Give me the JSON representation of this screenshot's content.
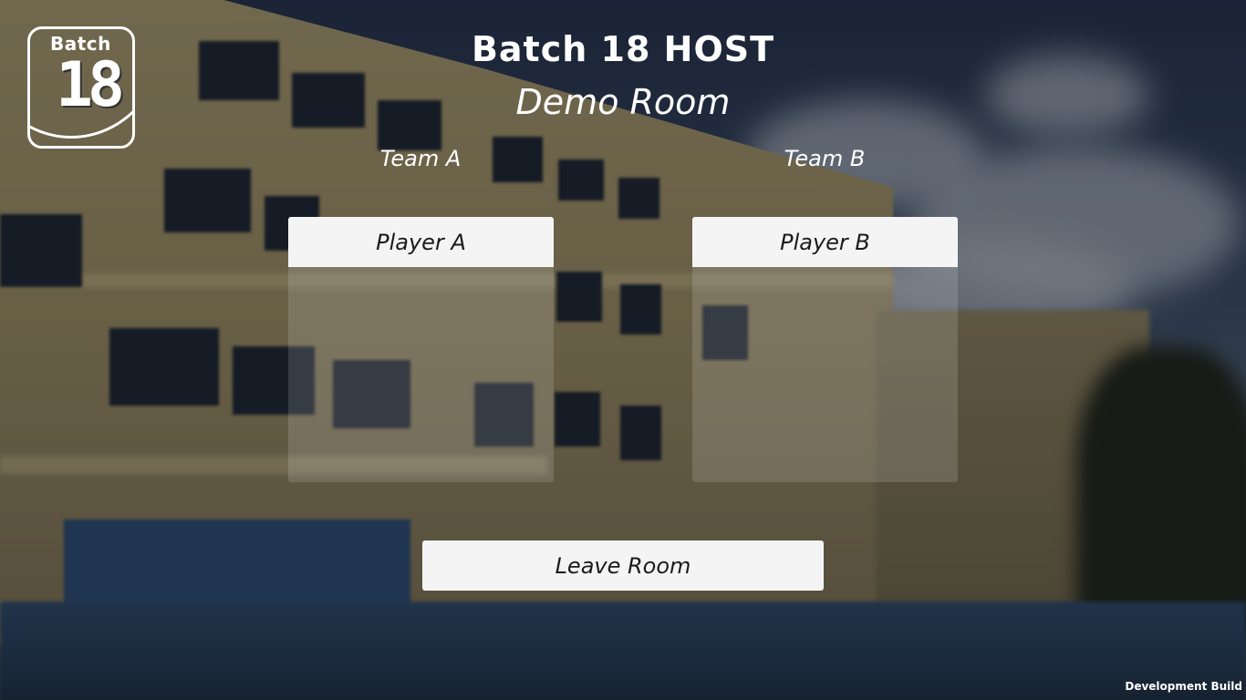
{
  "logo": {
    "text_top": "Batch",
    "text_number": "18"
  },
  "header": {
    "host_title": "Batch 18 HOST",
    "room_name": "Demo Room"
  },
  "teams": [
    {
      "label": "Team A",
      "players": [
        "Player A"
      ]
    },
    {
      "label": "Team B",
      "players": [
        "Player B"
      ]
    }
  ],
  "actions": {
    "leave_label": "Leave Room"
  },
  "footer": {
    "build_label": "Development Build"
  }
}
